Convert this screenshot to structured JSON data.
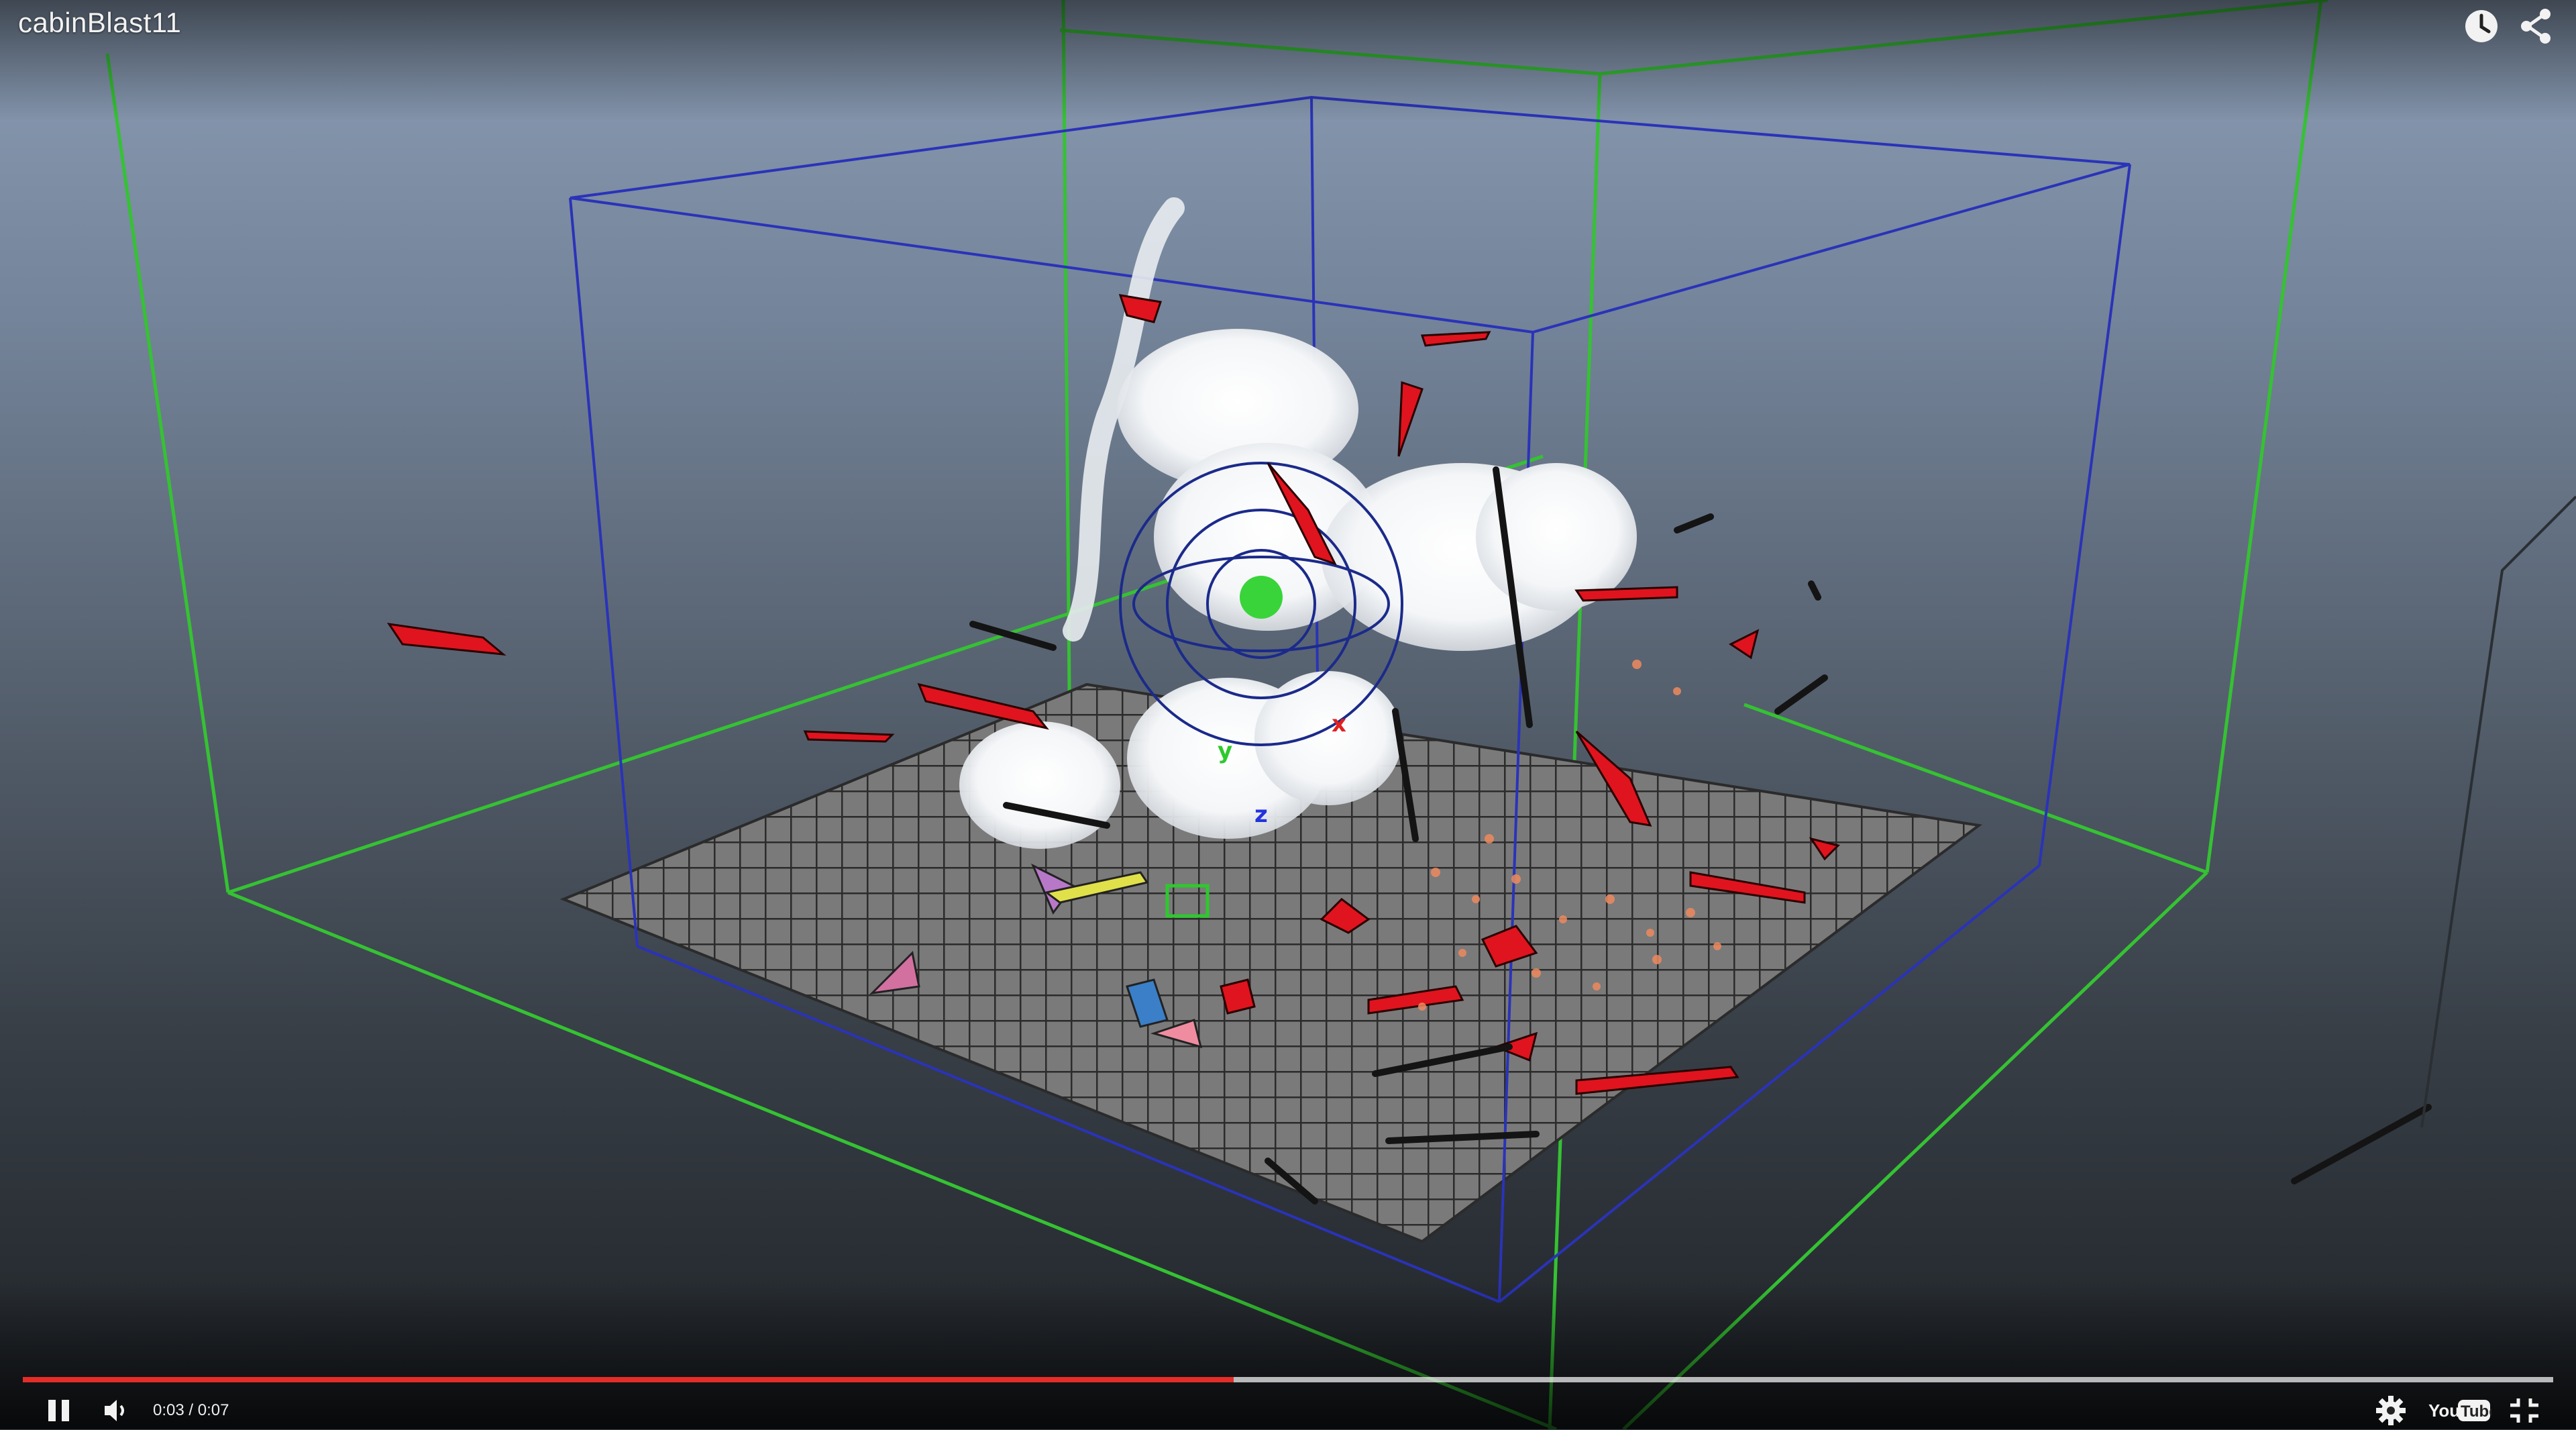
{
  "video": {
    "title": "cabinBlast11"
  },
  "top_icons": [
    {
      "name": "watch-later-icon"
    },
    {
      "name": "share-icon"
    }
  ],
  "player": {
    "current_time": "0:03",
    "duration": "0:07",
    "time_label": "0:03 / 0:07",
    "progress_fraction": 0.4786,
    "loaded_fraction": 1.0,
    "state": "playing",
    "logo_text": "YouTube"
  },
  "colors": {
    "progress_red": "#e52d27",
    "wire_green": "#35c233",
    "wire_blue": "#2a33b8",
    "fragment_red": "#e0141e"
  }
}
